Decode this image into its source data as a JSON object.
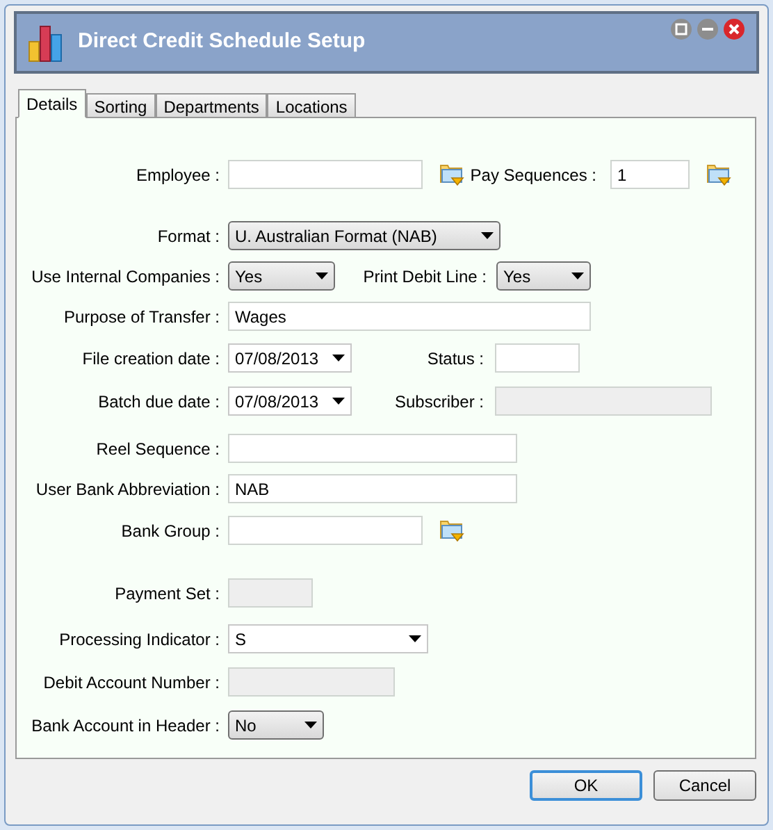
{
  "window": {
    "title": "Direct Credit Schedule Setup"
  },
  "tabs": [
    {
      "label": "Details",
      "selected": true
    },
    {
      "label": "Sorting",
      "selected": false
    },
    {
      "label": "Departments",
      "selected": false
    },
    {
      "label": "Locations",
      "selected": false
    }
  ],
  "rows": [
    {
      "fields": [
        {
          "label": "Employee :",
          "kind": "lookup"
        },
        {
          "label": "Pay Sequences :",
          "kind": "lookup",
          "value": "1"
        }
      ]
    },
    {
      "fields": [
        {
          "label": "Format :",
          "kind": "select",
          "value": "U. Australian Format (NAB)"
        }
      ]
    },
    {
      "fields": [
        {
          "label": "Use Internal Companies :",
          "kind": "select",
          "value": "Yes"
        },
        {
          "label": "Print Debit Line :",
          "kind": "select",
          "value": "Yes"
        }
      ]
    },
    {
      "fields": [
        {
          "label": "Purpose of Transfer :",
          "kind": "text",
          "value": "Wages",
          "disabled": false
        }
      ]
    },
    {
      "fields": [
        {
          "label": "File creation date :",
          "kind": "date",
          "value": "07/08/2013"
        },
        {
          "label": "Status :",
          "kind": "text",
          "disabled": false
        }
      ]
    },
    {
      "fields": [
        {
          "label": "Batch due date :",
          "kind": "date",
          "value": "07/08/2013"
        },
        {
          "label": "Subscriber :",
          "kind": "text",
          "disabled": true
        }
      ]
    },
    {
      "fields": [
        {
          "label": "Reel Sequence :",
          "kind": "text",
          "disabled": false
        }
      ]
    },
    {
      "fields": [
        {
          "label": "User Bank Abbreviation :",
          "kind": "text",
          "value": "NAB",
          "disabled": false
        }
      ]
    },
    {
      "fields": [
        {
          "label": "Bank Group :",
          "kind": "lookup"
        }
      ]
    },
    {
      "fields": [
        {
          "label": "Payment Set :",
          "kind": "text",
          "disabled": true
        }
      ]
    },
    {
      "fields": [
        {
          "label": "Processing Indicator :",
          "kind": "combo",
          "value": "S"
        }
      ]
    },
    {
      "fields": [
        {
          "label": "Debit Account Number :",
          "kind": "text",
          "disabled": true
        }
      ]
    },
    {
      "fields": [
        {
          "label": "Bank Account in Header :",
          "kind": "select",
          "value": "No"
        }
      ]
    }
  ],
  "buttons": [
    {
      "label": "OK",
      "default": true
    },
    {
      "label": "Cancel",
      "default": false
    }
  ]
}
